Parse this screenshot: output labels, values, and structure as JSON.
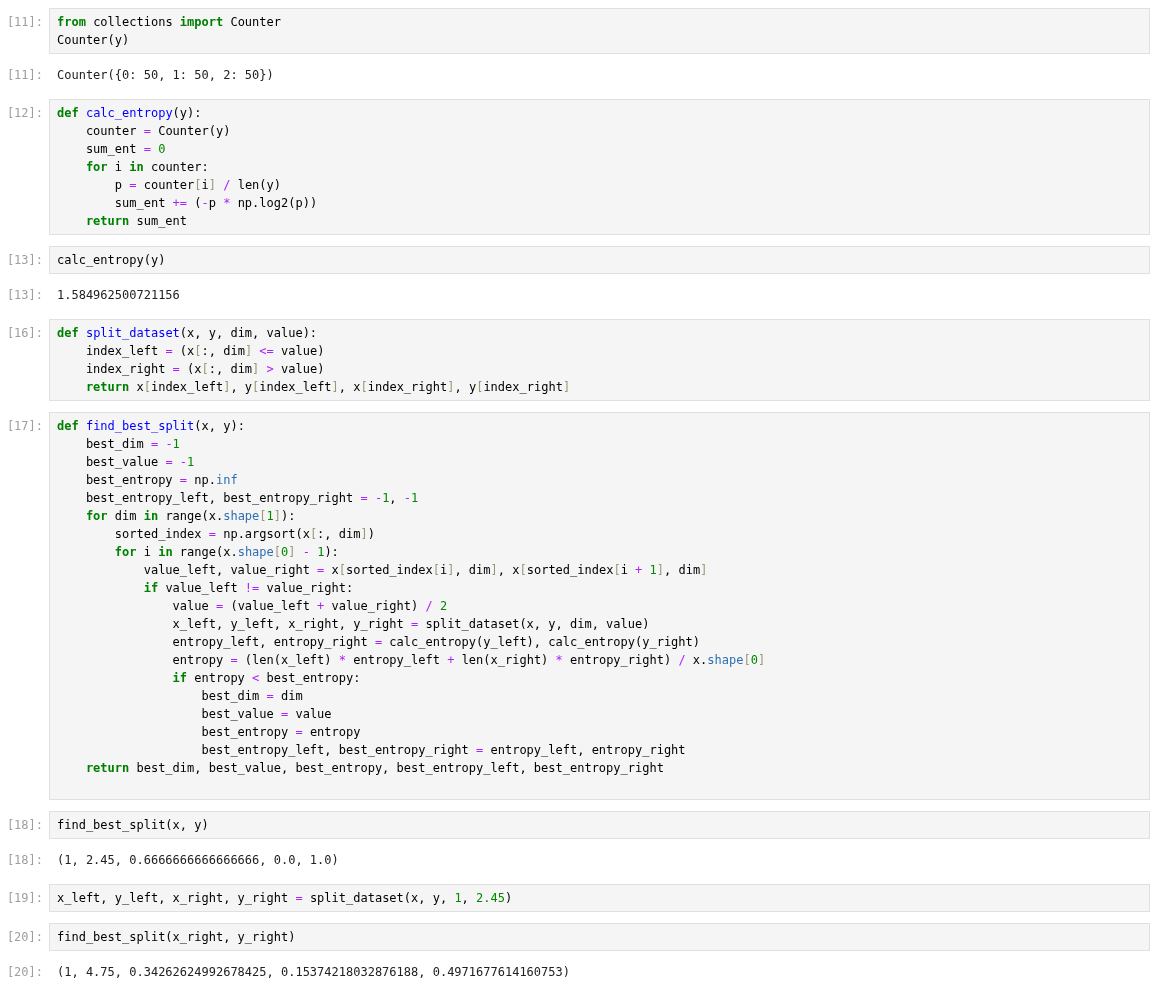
{
  "cells": [
    {
      "prompt": "[11]:",
      "input": [
        [
          {
            "kind": "keyword",
            "text": "from"
          },
          " collections ",
          {
            "kind": "keyword",
            "text": "import"
          },
          " Counter"
        ],
        [
          "Counter(y)"
        ]
      ],
      "output_prompt": "[11]:",
      "output": "Counter({0: 50, 1: 50, 2: 50})"
    },
    {
      "prompt": "[12]:",
      "input": [
        [
          {
            "kind": "keyword",
            "text": "def "
          },
          {
            "kind": "function",
            "text": "calc_entropy"
          },
          "(y):"
        ],
        [
          "    counter ",
          {
            "kind": "operator",
            "text": "="
          },
          " Counter(y)"
        ],
        [
          "    sum_ent ",
          {
            "kind": "operator",
            "text": "="
          },
          {
            "kind": "number",
            "text": " 0"
          }
        ],
        [
          {
            "kind": "keyword",
            "text": "    for"
          },
          " i ",
          {
            "kind": "keyword",
            "text": "in"
          },
          " counter:"
        ],
        [
          "        p ",
          {
            "kind": "operator",
            "text": "="
          },
          " counter",
          {
            "kind": "bracket",
            "text": "["
          },
          "i",
          {
            "kind": "bracket",
            "text": "]"
          },
          {
            "kind": "operator",
            "text": " /"
          },
          " len(y)"
        ],
        [
          "        sum_ent ",
          {
            "kind": "operator",
            "text": "+="
          },
          " (",
          {
            "kind": "operator",
            "text": "-"
          },
          "p ",
          {
            "kind": "operator",
            "text": "*"
          },
          " np.log2(p))"
        ],
        [
          {
            "kind": "keyword",
            "text": "    return"
          },
          " sum_ent"
        ]
      ]
    },
    {
      "prompt": "[13]:",
      "input": [
        [
          "calc_entropy(y)"
        ]
      ],
      "output_prompt": "[13]:",
      "output": "1.584962500721156"
    },
    {
      "prompt": "[16]:",
      "input": [
        [
          {
            "kind": "keyword",
            "text": "def "
          },
          {
            "kind": "function",
            "text": "split_dataset"
          },
          "(x, y, dim, value):"
        ],
        [
          "    index_left ",
          {
            "kind": "operator",
            "text": "="
          },
          " (x",
          {
            "kind": "bracket",
            "text": "["
          },
          ":, dim",
          {
            "kind": "bracket",
            "text": "]"
          },
          {
            "kind": "operator",
            "text": " <="
          },
          " value)"
        ],
        [
          "    index_right ",
          {
            "kind": "operator",
            "text": "="
          },
          " (x",
          {
            "kind": "bracket",
            "text": "["
          },
          ":, dim",
          {
            "kind": "bracket",
            "text": "]"
          },
          {
            "kind": "operator",
            "text": " >"
          },
          " value)"
        ],
        [
          {
            "kind": "keyword",
            "text": "    return"
          },
          " x",
          {
            "kind": "bracket",
            "text": "["
          },
          "index_left",
          {
            "kind": "bracket",
            "text": "]"
          },
          ", y",
          {
            "kind": "bracket",
            "text": "["
          },
          "index_left",
          {
            "kind": "bracket",
            "text": "]"
          },
          ", x",
          {
            "kind": "bracket",
            "text": "["
          },
          "index_right",
          {
            "kind": "bracket",
            "text": "]"
          },
          ", y",
          {
            "kind": "bracket",
            "text": "["
          },
          "index_right",
          {
            "kind": "bracket",
            "text": "]"
          }
        ]
      ]
    },
    {
      "prompt": "[17]:",
      "trailing_blank_line": true,
      "input": [
        [
          {
            "kind": "keyword",
            "text": "def "
          },
          {
            "kind": "function",
            "text": "find_best_split"
          },
          "(x, y):"
        ],
        [
          "    best_dim ",
          {
            "kind": "operator",
            "text": "="
          },
          {
            "kind": "operator",
            "text": " -"
          },
          {
            "kind": "number",
            "text": "1"
          }
        ],
        [
          "    best_value ",
          {
            "kind": "operator",
            "text": "="
          },
          {
            "kind": "operator",
            "text": " -"
          },
          {
            "kind": "number",
            "text": "1"
          }
        ],
        [
          "    best_entropy ",
          {
            "kind": "operator",
            "text": "="
          },
          " np.",
          {
            "kind": "attribute",
            "text": "inf"
          }
        ],
        [
          "    best_entropy_left, best_entropy_right ",
          {
            "kind": "operator",
            "text": "="
          },
          {
            "kind": "operator",
            "text": " -"
          },
          {
            "kind": "number",
            "text": "1"
          },
          ", ",
          {
            "kind": "operator",
            "text": "-"
          },
          {
            "kind": "number",
            "text": "1"
          }
        ],
        [
          {
            "kind": "keyword",
            "text": "    for"
          },
          " dim ",
          {
            "kind": "keyword",
            "text": "in"
          },
          " range(x.",
          {
            "kind": "attribute",
            "text": "shape"
          },
          {
            "kind": "bracket",
            "text": "["
          },
          {
            "kind": "number",
            "text": "1"
          },
          {
            "kind": "bracket",
            "text": "]"
          },
          "):"
        ],
        [
          "        sorted_index ",
          {
            "kind": "operator",
            "text": "="
          },
          " np.argsort(x",
          {
            "kind": "bracket",
            "text": "["
          },
          ":, dim",
          {
            "kind": "bracket",
            "text": "]"
          },
          ")"
        ],
        [
          {
            "kind": "keyword",
            "text": "        for"
          },
          " i ",
          {
            "kind": "keyword",
            "text": "in"
          },
          " range(x.",
          {
            "kind": "attribute",
            "text": "shape"
          },
          {
            "kind": "bracket",
            "text": "["
          },
          {
            "kind": "number",
            "text": "0"
          },
          {
            "kind": "bracket",
            "text": "]"
          },
          {
            "kind": "operator",
            "text": " -"
          },
          {
            "kind": "number",
            "text": " 1"
          },
          "):"
        ],
        [
          "            value_left, value_right ",
          {
            "kind": "operator",
            "text": "="
          },
          " x",
          {
            "kind": "bracket",
            "text": "["
          },
          "sorted_index",
          {
            "kind": "bracket",
            "text": "["
          },
          "i",
          {
            "kind": "bracket",
            "text": "]"
          },
          ", dim",
          {
            "kind": "bracket",
            "text": "]"
          },
          ", x",
          {
            "kind": "bracket",
            "text": "["
          },
          "sorted_index",
          {
            "kind": "bracket",
            "text": "["
          },
          "i ",
          {
            "kind": "operator",
            "text": "+"
          },
          {
            "kind": "number",
            "text": " 1"
          },
          {
            "kind": "bracket",
            "text": "]"
          },
          ", dim",
          {
            "kind": "bracket",
            "text": "]"
          }
        ],
        [
          {
            "kind": "keyword",
            "text": "            if"
          },
          " value_left ",
          {
            "kind": "operator",
            "text": "!="
          },
          " value_right:"
        ],
        [
          "                value ",
          {
            "kind": "operator",
            "text": "="
          },
          " (value_left ",
          {
            "kind": "operator",
            "text": "+"
          },
          " value_right) ",
          {
            "kind": "operator",
            "text": "/"
          },
          {
            "kind": "number",
            "text": " 2"
          }
        ],
        [
          "                x_left, y_left, x_right, y_right ",
          {
            "kind": "operator",
            "text": "="
          },
          " split_dataset(x, y, dim, value)"
        ],
        [
          "                entropy_left, entropy_right ",
          {
            "kind": "operator",
            "text": "="
          },
          " calc_entropy(y_left), calc_entropy(y_right)"
        ],
        [
          "                entropy ",
          {
            "kind": "operator",
            "text": "="
          },
          " (len(x_left) ",
          {
            "kind": "operator",
            "text": "*"
          },
          " entropy_left ",
          {
            "kind": "operator",
            "text": "+"
          },
          " len(x_right) ",
          {
            "kind": "operator",
            "text": "*"
          },
          " entropy_right) ",
          {
            "kind": "operator",
            "text": "/"
          },
          " x.",
          {
            "kind": "attribute",
            "text": "shape"
          },
          {
            "kind": "bracket",
            "text": "["
          },
          {
            "kind": "number",
            "text": "0"
          },
          {
            "kind": "bracket",
            "text": "]"
          }
        ],
        [
          {
            "kind": "keyword",
            "text": "                if"
          },
          " entropy ",
          {
            "kind": "operator",
            "text": "<"
          },
          " best_entropy:"
        ],
        [
          "                    best_dim ",
          {
            "kind": "operator",
            "text": "="
          },
          " dim"
        ],
        [
          "                    best_value ",
          {
            "kind": "operator",
            "text": "="
          },
          " value"
        ],
        [
          "                    best_entropy ",
          {
            "kind": "operator",
            "text": "="
          },
          " entropy"
        ],
        [
          "                    best_entropy_left, best_entropy_right ",
          {
            "kind": "operator",
            "text": "="
          },
          " entropy_left, entropy_right"
        ],
        [
          {
            "kind": "keyword",
            "text": "    return"
          },
          " best_dim, best_value, best_entropy, best_entropy_left, best_entropy_right"
        ]
      ]
    },
    {
      "prompt": "[18]:",
      "input": [
        [
          "find_best_split(x, y)"
        ]
      ],
      "output_prompt": "[18]:",
      "output": "(1, 2.45, 0.6666666666666666, 0.0, 1.0)"
    },
    {
      "prompt": "[19]:",
      "input": [
        [
          "x_left, y_left, x_right, y_right ",
          {
            "kind": "operator",
            "text": "="
          },
          " split_dataset(x, y, ",
          {
            "kind": "number",
            "text": "1"
          },
          ", ",
          {
            "kind": "number",
            "text": "2.45"
          },
          ")"
        ]
      ]
    },
    {
      "prompt": "[20]:",
      "input": [
        [
          "find_best_split(x_right, y_right)"
        ]
      ],
      "output_prompt": "[20]:",
      "output": "(1, 4.75, 0.34262624992678425, 0.15374218032876188, 0.4971677614160753)"
    }
  ]
}
